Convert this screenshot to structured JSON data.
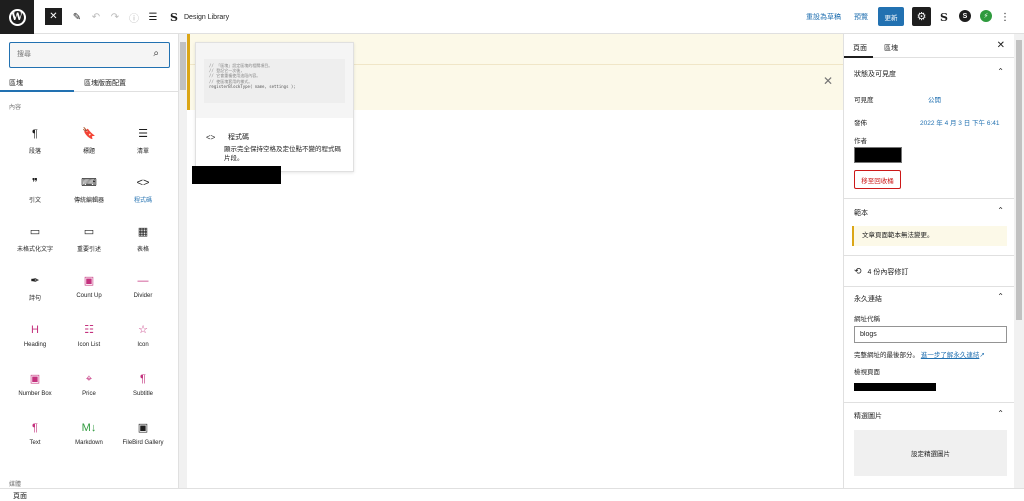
{
  "topbar": {
    "design_library_label": "Design Library",
    "switch_to_draft_label": "重設為草稿",
    "preview_label": "預覽",
    "update_label": "更新"
  },
  "inserter": {
    "search_placeholder": "搜尋",
    "tabs": [
      "區塊",
      "區塊版面配置"
    ],
    "section_label": "內容",
    "blocks": [
      {
        "label": "段落",
        "icon": "paragraph-icon",
        "glyph": "¶",
        "color": "dark"
      },
      {
        "label": "標題",
        "icon": "bookmark-icon",
        "glyph": "🔖",
        "color": "dark"
      },
      {
        "label": "清單",
        "icon": "list-icon",
        "glyph": "☰",
        "color": "dark"
      },
      {
        "label": "引文",
        "icon": "quote-icon",
        "glyph": "❞",
        "color": "dark"
      },
      {
        "label": "傳統編輯器",
        "icon": "keyboard-icon",
        "glyph": "⌨",
        "color": "dark"
      },
      {
        "label": "程式碼",
        "icon": "code-icon",
        "glyph": "<>",
        "color": "dark",
        "selected": true
      },
      {
        "label": "未格式化文字",
        "icon": "preformatted-icon",
        "glyph": "▭",
        "color": "dark"
      },
      {
        "label": "重要引述",
        "icon": "pullquote-icon",
        "glyph": "▭",
        "color": "dark"
      },
      {
        "label": "表格",
        "icon": "table-icon",
        "glyph": "▦",
        "color": "dark"
      },
      {
        "label": "詩句",
        "icon": "feather-icon",
        "glyph": "✒",
        "color": "dark"
      },
      {
        "label": "Count Up",
        "icon": "count-up-icon",
        "glyph": "▣",
        "color": "pink"
      },
      {
        "label": "Divider",
        "icon": "divider-icon",
        "glyph": "—",
        "color": "pink"
      },
      {
        "label": "Heading",
        "icon": "heading-icon",
        "glyph": "H",
        "color": "pink"
      },
      {
        "label": "Icon List",
        "icon": "icon-list-icon",
        "glyph": "☷",
        "color": "pink"
      },
      {
        "label": "Icon",
        "icon": "star-icon",
        "glyph": "☆",
        "color": "pink"
      },
      {
        "label": "Number Box",
        "icon": "number-box-icon",
        "glyph": "▣",
        "color": "pink"
      },
      {
        "label": "Price",
        "icon": "price-tag-icon",
        "glyph": "⌖",
        "color": "pink"
      },
      {
        "label": "Subtitle",
        "icon": "subtitle-icon",
        "glyph": "¶",
        "color": "pink"
      },
      {
        "label": "Text",
        "icon": "text-icon",
        "glyph": "¶",
        "color": "pink"
      },
      {
        "label": "Markdown",
        "icon": "markdown-icon",
        "glyph": "M↓",
        "color": "green"
      },
      {
        "label": "FileBird Gallery",
        "icon": "gallery-icon",
        "glyph": "▣",
        "color": "dark"
      }
    ],
    "bottom_section_label": "媒體"
  },
  "preview": {
    "code_lines": [
      "// 「區塊」設定區塊的相關項目。",
      "// 登記它一次後，",
      "// 它會重複使用這段內容。",
      "// 使區塊套用的樣式。",
      "registerBlockType( name, settings );"
    ],
    "title": "程式碼",
    "description": "顯示完全保持空格及定位點不變的程式碼片段。"
  },
  "sidebar": {
    "tabs": [
      "頁面",
      "區塊"
    ],
    "status_title": "狀態及可見度",
    "visibility_label": "可見度",
    "visibility_value": "公開",
    "publish_label": "發佈",
    "publish_value": "2022 年 4 月 3 日 下午 6:41",
    "author_label": "作者",
    "trash_label": "移至回收桶",
    "template_title": "範本",
    "template_notice": "文章頁面範本無法變更。",
    "revisions_label": "4 份內容修訂",
    "permalink_title": "永久連結",
    "slug_label": "網址代稱",
    "slug_value": "blogs",
    "slug_help_text": "完整網址的最後部分。",
    "slug_help_link": "進一步了解永久連結",
    "view_page_label": "檢視頁面",
    "featured_title": "精選圖片",
    "featured_button": "設定精選圖片"
  },
  "footer": {
    "breadcrumb": "頁面"
  },
  "colors": {
    "accent": "#2271b1",
    "dark": "#1e1e1e",
    "notice_bg": "#fcf9e8",
    "notice_border": "#dba617",
    "danger": "#cc1818",
    "plugin_pink": "#c4327e",
    "plugin_green": "#2e9a3d"
  }
}
